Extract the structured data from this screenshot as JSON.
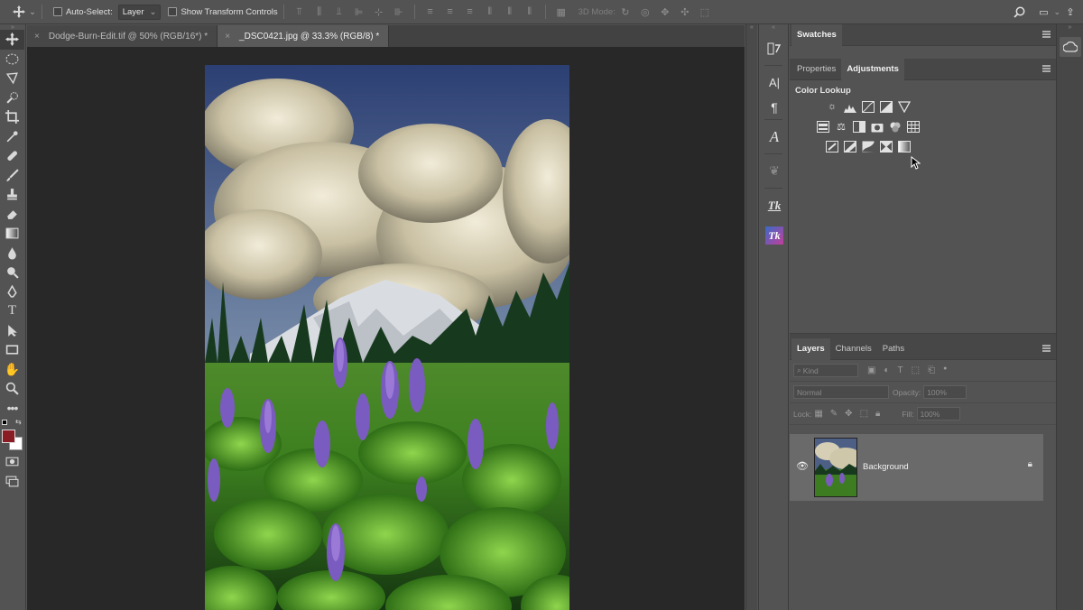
{
  "options_bar": {
    "auto_select_label": "Auto-Select:",
    "auto_select_value": "Layer",
    "transform_label": "Show Transform Controls",
    "mode_3d_label": "3D Mode:"
  },
  "tabs": [
    {
      "title": "Dodge-Burn-Edit.tif @ 50% (RGB/16*) *",
      "active": false
    },
    {
      "title": "_DSC0421.jpg @ 33.3% (RGB/8) *",
      "active": true
    }
  ],
  "tools": [
    "move-tool",
    "marquee-tool",
    "lasso-tool",
    "quick-selection-tool",
    "crop-tool",
    "eyedropper-tool",
    "healing-brush-tool",
    "brush-tool",
    "clone-stamp-tool",
    "eraser-tool",
    "gradient-tool",
    "blur-tool",
    "dodge-tool",
    "pen-tool",
    "type-tool",
    "path-selection-tool",
    "rectangle-tool",
    "hand-tool",
    "zoom-tool",
    "more-tools"
  ],
  "colors": {
    "foreground": "#8a1c24",
    "background": "#ffffff",
    "accent": "#5c5c5c"
  },
  "swatches_panel": {
    "tab": "Swatches"
  },
  "adjustments_panel": {
    "tabs": [
      {
        "label": "Properties",
        "active": false
      },
      {
        "label": "Adjustments",
        "active": true
      }
    ],
    "hover_label": "Color Lookup",
    "rows": [
      [
        "brightness-contrast-icon",
        "levels-icon",
        "curves-icon",
        "exposure-icon",
        "vibrance-icon"
      ],
      [
        "hue-saturation-icon",
        "color-balance-icon",
        "black-white-icon",
        "photo-filter-icon",
        "channel-mixer-icon",
        "color-lookup-icon"
      ],
      [
        "invert-icon",
        "posterize-icon",
        "threshold-icon",
        "selective-color-icon",
        "gradient-map-icon"
      ]
    ]
  },
  "layers_panel": {
    "tabs": [
      {
        "label": "Layers",
        "active": true
      },
      {
        "label": "Channels",
        "active": false
      },
      {
        "label": "Paths",
        "active": false
      }
    ],
    "filter_placeholder": "Kind",
    "blend_mode": "Normal",
    "opacity_label": "Opacity:",
    "opacity_value": "100%",
    "lock_label": "Lock:",
    "fill_label": "Fill:",
    "fill_value": "100%",
    "layers": [
      {
        "name": "Background",
        "visible": true,
        "locked": true
      }
    ]
  }
}
